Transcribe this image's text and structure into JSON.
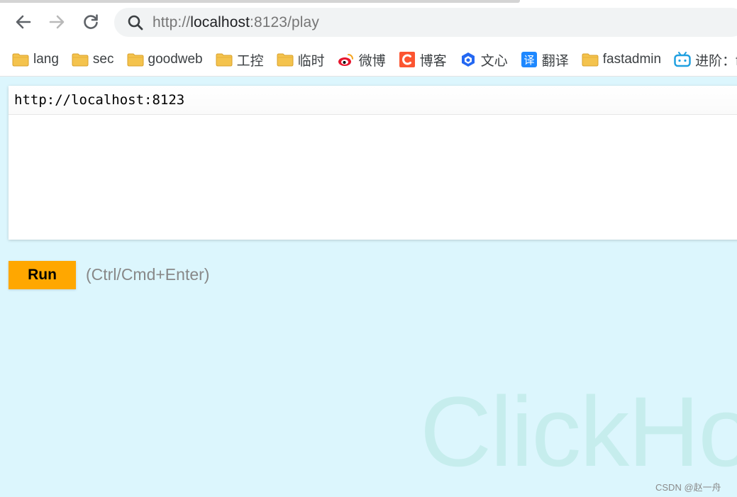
{
  "browser": {
    "address_bar": {
      "url_prefix": "http://",
      "url_host": "localhost",
      "url_rest": ":8123/play"
    },
    "bookmarks": [
      {
        "label": "lang",
        "icon": "folder-icon"
      },
      {
        "label": "sec",
        "icon": "folder-icon"
      },
      {
        "label": "goodweb",
        "icon": "folder-icon"
      },
      {
        "label": "工控",
        "icon": "folder-icon"
      },
      {
        "label": "临时",
        "icon": "folder-icon"
      },
      {
        "label": "微博",
        "icon": "weibo-icon"
      },
      {
        "label": "博客",
        "icon": "csdn-icon"
      },
      {
        "label": "文心",
        "icon": "wenxin-icon"
      },
      {
        "label": "翻译",
        "icon": "translate-icon"
      },
      {
        "label": "fastadmin",
        "icon": "folder-icon"
      },
      {
        "label": "进阶：f",
        "icon": "bilibili-icon"
      }
    ]
  },
  "editor": {
    "text": "http://localhost:8123"
  },
  "run_button": {
    "label": "Run"
  },
  "shortcut_hint": "(Ctrl/Cmd+Enter)",
  "watermark": "ClickHo",
  "credit": "CSDN @赵一舟",
  "colors": {
    "page_bg": "#dcf6fd",
    "run_bg": "#ffa700",
    "folder": "#f4c34d",
    "weibo": "#e6162d",
    "csdn": "#fc5531",
    "wenxin": "#2468f2",
    "translate": "#1e88ff",
    "bilibili": "#20a0e0"
  }
}
